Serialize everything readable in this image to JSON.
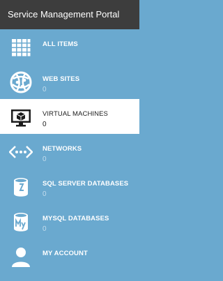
{
  "header": {
    "title": "Service Management Portal"
  },
  "nav": [
    {
      "label": "ALL ITEMS",
      "count": null,
      "icon": "grid-icon"
    },
    {
      "label": "WEB SITES",
      "count": "0",
      "icon": "globe-icon"
    },
    {
      "label": "VIRTUAL MACHINES",
      "count": "0",
      "icon": "monitor-icon",
      "selected": true
    },
    {
      "label": "NETWORKS",
      "count": "0",
      "icon": "network-icon"
    },
    {
      "label": "SQL SERVER DATABASES",
      "count": "0",
      "icon": "database-icon"
    },
    {
      "label": "MYSQL DATABASES",
      "count": "0",
      "icon": "mysql-icon"
    },
    {
      "label": "MY ACCOUNT",
      "count": null,
      "icon": "user-icon"
    }
  ],
  "colors": {
    "header_bg": "#3d3d3d",
    "sidebar_bg": "#6aa9cf",
    "selected_bg": "#ffffff",
    "text": "#ffffff",
    "count_text": "#c4ddee"
  }
}
